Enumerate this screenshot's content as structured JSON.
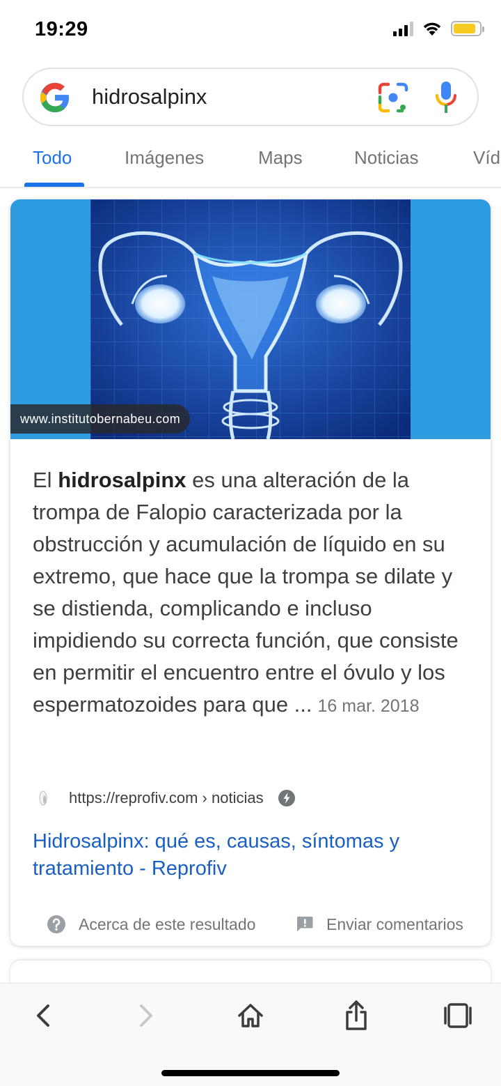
{
  "status_bar": {
    "time": "19:29",
    "icons": [
      "cellular-signal-icon",
      "wifi-icon",
      "battery-icon"
    ],
    "battery_level": 0.85,
    "battery_color": "#f6cc22"
  },
  "search": {
    "query": "hidrosalpinx",
    "icons": [
      "google-logo-icon",
      "lens-icon",
      "mic-icon"
    ]
  },
  "tabs": [
    {
      "label": "Todo",
      "active": true
    },
    {
      "label": "Imágenes",
      "active": false
    },
    {
      "label": "Maps",
      "active": false
    },
    {
      "label": "Noticias",
      "active": false
    },
    {
      "label": "Víd",
      "active": false
    }
  ],
  "featured_snippet": {
    "image_source": "www.institutobernabeu.com",
    "text_before": "El ",
    "text_bold": "hidrosalpinx",
    "text_after": " es una alteración de la trompa de Falopio caracterizada por la obstrucción y acumulación de líquido en su extremo, que hace que la trompa se dilate y se distienda, complicando e incluso impidiendo su correcta función, que consiste en permitir el encuentro entre el óvulo y los espermatozoides para que ...",
    "date": "16 mar. 2018",
    "cite_url": "https://reprofiv.com › noticias",
    "title": "Hidrosalpinx: qué es, causas, síntomas y tratamiento - Reprofiv",
    "about_label": "Acerca de este resultado",
    "feedback_label": "Enviar comentarios"
  },
  "toolbar": {
    "icons": [
      "back-icon",
      "forward-icon",
      "home-icon",
      "share-icon",
      "tabs-icon"
    ]
  },
  "colors": {
    "accent": "#1a73e8",
    "link": "#1a5fc4",
    "hero_background": "#2f9be0"
  }
}
